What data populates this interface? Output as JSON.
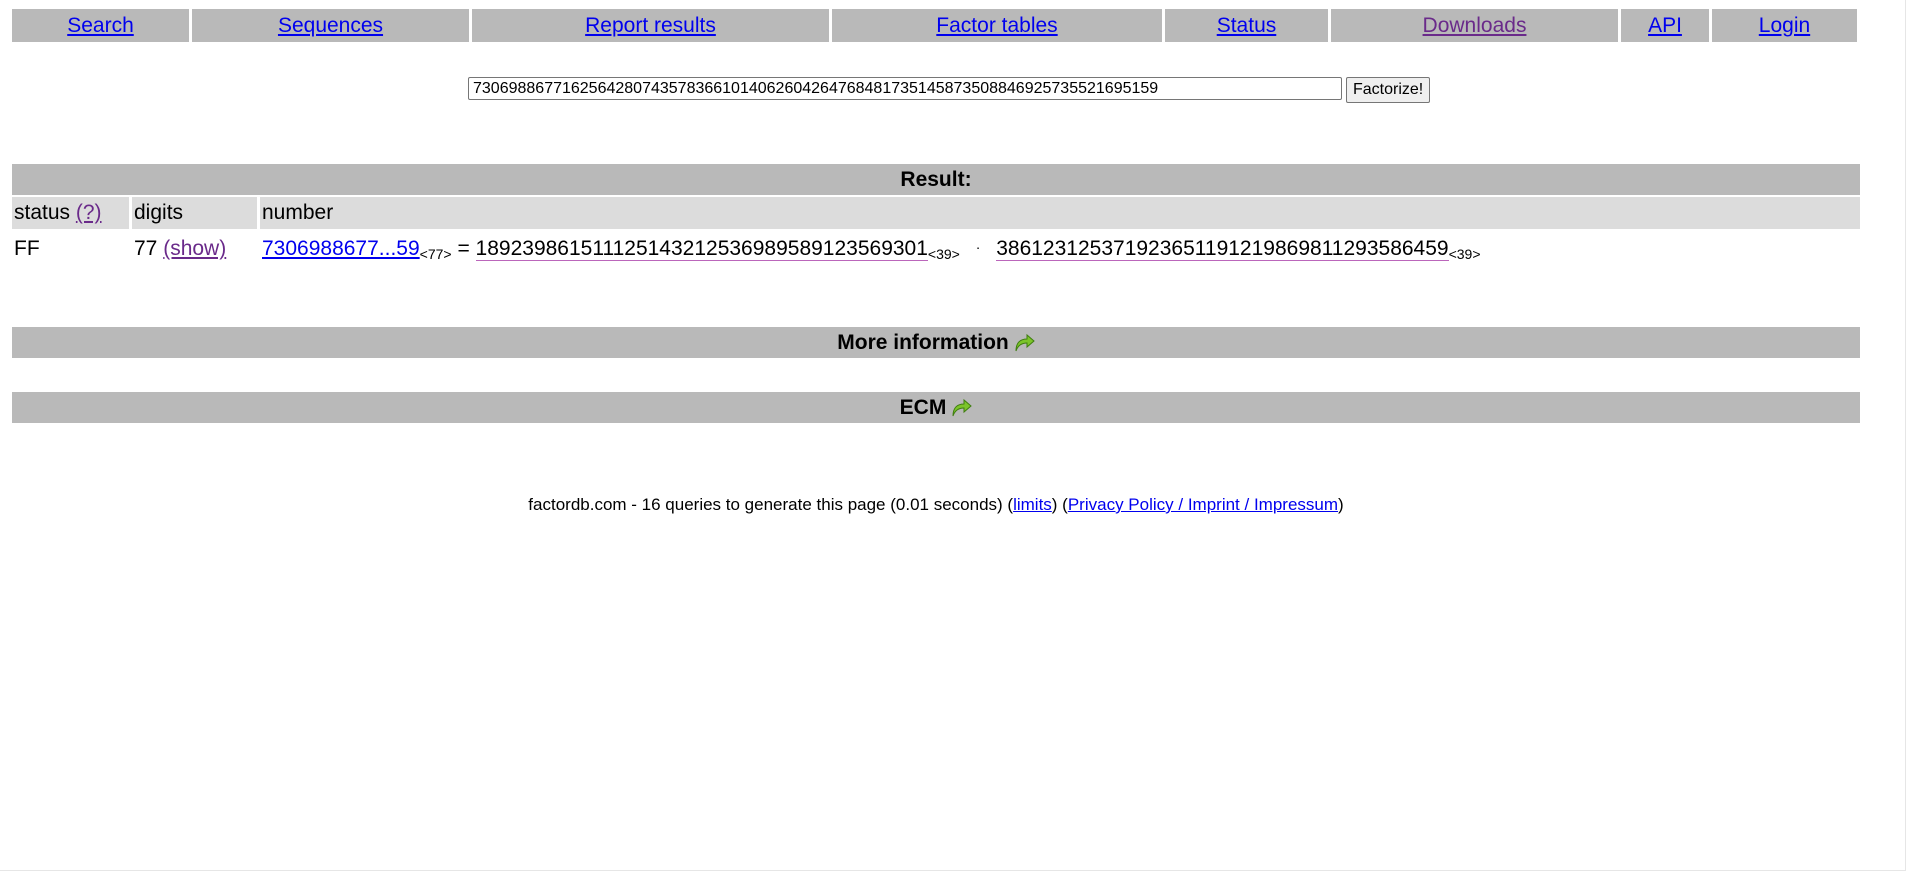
{
  "nav": {
    "items": [
      "Search",
      "Sequences",
      "Report results",
      "Factor tables",
      "Status",
      "Downloads",
      "API",
      "Login"
    ]
  },
  "search": {
    "value": "73069886771625642807435783661014062604264768481735145873508846925735521695159",
    "button": "Factorize!"
  },
  "result": {
    "title": "Result:",
    "headers": {
      "status": "status",
      "status_help": "(?)",
      "digits": "digits",
      "number": "number"
    },
    "row": {
      "status": "FF",
      "digits": "77",
      "show": "(show)",
      "number_short": "7306988677...59",
      "number_digits": "<77>",
      "equals": "=",
      "factor1": "189239861511125143212536989589123569301",
      "factor1_digits": "<39>",
      "times": "·",
      "factor2": "386123125371923651191219869811293586459",
      "factor2_digits": "<39>"
    }
  },
  "sections": {
    "more_info": "More information",
    "ecm": "ECM"
  },
  "footer": {
    "prefix": "factordb.com - 16 queries to generate this page (0.01 seconds) (",
    "limits": "limits",
    "mid": ") (",
    "privacy": "Privacy Policy / Imprint / Impressum",
    "suffix": ")"
  },
  "colors": {
    "bar": "#b9b9b9",
    "header_row": "#dcdcdc",
    "link": "#0000ee",
    "visited": "#6a2a8a",
    "arrow": "#7cc42a"
  }
}
